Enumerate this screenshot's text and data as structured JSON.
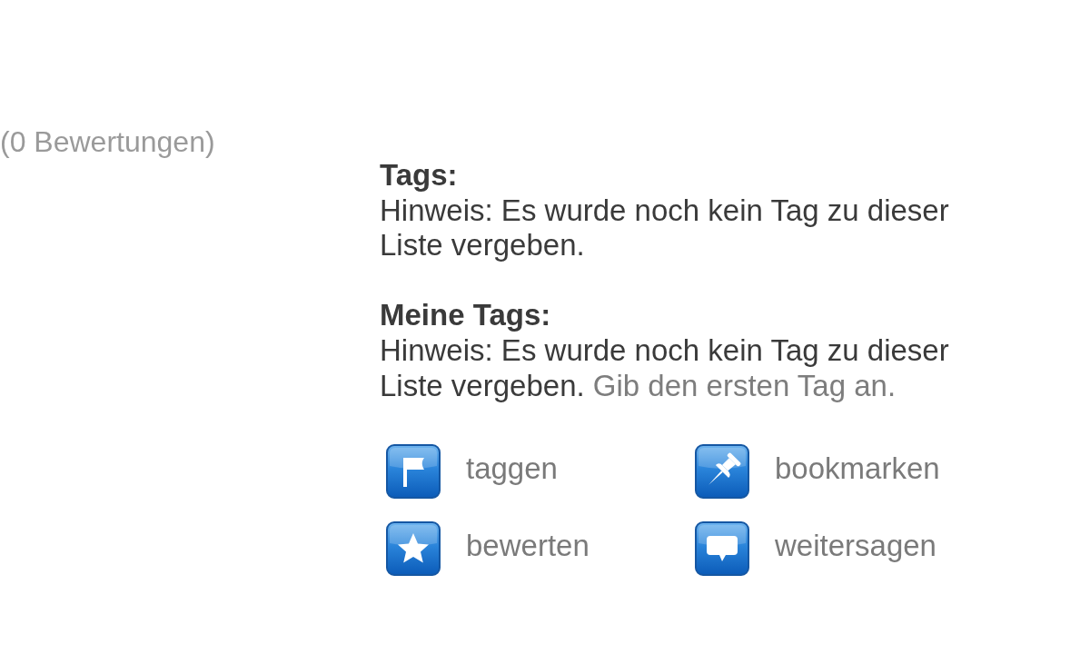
{
  "rating": {
    "count_text": "(0 Bewertungen)"
  },
  "tags": {
    "heading": "Tags:",
    "note": "Hinweis: Es wurde noch kein Tag zu dieser Liste vergeben."
  },
  "my_tags": {
    "heading": "Meine Tags:",
    "note": "Hinweis: Es wurde noch kein Tag zu dieser Liste vergeben.",
    "link": "Gib den ersten Tag an."
  },
  "actions": [
    {
      "kind": "tag",
      "label": "taggen"
    },
    {
      "kind": "bookmark",
      "label": "bookmarken"
    },
    {
      "kind": "rate",
      "label": "bewerten"
    },
    {
      "kind": "share",
      "label": "weitersagen"
    }
  ]
}
